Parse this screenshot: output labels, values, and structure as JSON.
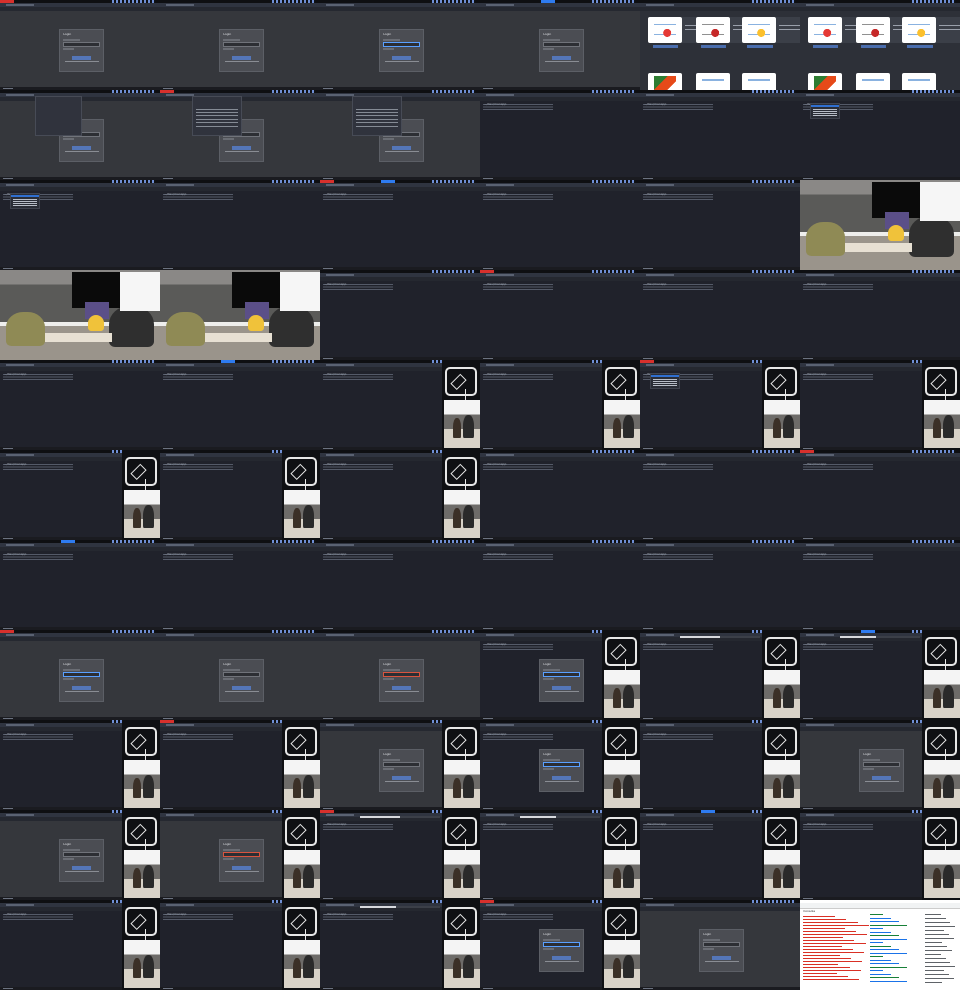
{
  "app": {
    "tab_title": "MANAPP Login/Settings",
    "dialog_title": "Login",
    "ide_address": "~/dev/manapp",
    "devtools_title": "Console"
  },
  "thumbnail_cards": [
    {
      "icon": "cup-and-apple-icon"
    },
    {
      "icon": "bowl-icon"
    },
    {
      "icon": "cup-and-banana-icon"
    },
    {
      "icon": "carrot-icon"
    },
    {
      "icon": "cup-icon"
    },
    {
      "icon": "cup-icon"
    }
  ],
  "progress": [
    0.36,
    0.5,
    0.45,
    0.62,
    0.58
  ],
  "colors": {
    "accent": "#5476b8",
    "field_focus": "#5aa0ff",
    "field_error": "#d8543f",
    "window_bg": "#23252d"
  }
}
